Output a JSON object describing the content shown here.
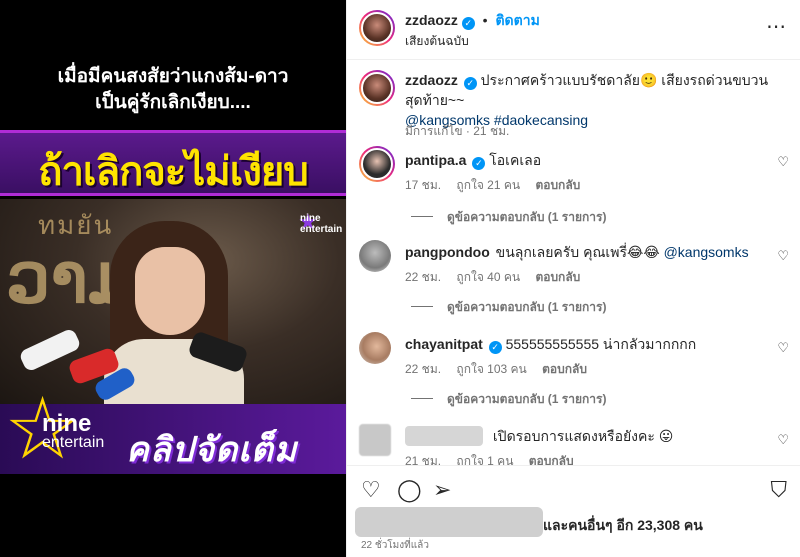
{
  "media": {
    "caption_line1": "เมื่อมีคนสงสัยว่าแกงส้ม-ดาว",
    "caption_line2": "เป็นคู่รักเลิกเงียบ....",
    "headline": "ถ้าเลิกจะไม่เงียบ",
    "background_text_top": "ทมยัน",
    "background_text_large": "ວາມ",
    "watermark_small": "nine entertain",
    "brand_nine": "nine",
    "brand_entertain": "entertain",
    "clip_label": "คลิปจัดเต็ม"
  },
  "post": {
    "author": "zzdaozz",
    "follow_label": "ติดตาม",
    "audio_label": "เสียงต้นฉบับ",
    "more_icon": "more-options-icon",
    "caption": {
      "username": "zzdaozz",
      "text": "ประกาศคร้าวแบบรัชดาลัย🙂 เสียงรถด่วนขบวนสุดท้าย~~",
      "mentions": "@kangsomks #daokecansing",
      "edited": "มีการแก้ไข · 21 ชม."
    }
  },
  "comments": [
    {
      "username": "pantipa.a",
      "verified": true,
      "text": "โอเคเลอ",
      "time": "17 ชม.",
      "likes": "ถูกใจ 21 คน",
      "reply": "ตอบกลับ",
      "view_replies": "ดูข้อความตอบกลับ (1 รายการ)"
    },
    {
      "username": "pangpondoo",
      "verified": false,
      "text": "ขนลุกเลยครับ คุณเพรี่😂😂 ",
      "mention": "@kangsomks",
      "time": "22 ชม.",
      "likes": "ถูกใจ 40 คน",
      "reply": "ตอบกลับ",
      "view_replies": "ดูข้อความตอบกลับ (1 รายการ)"
    },
    {
      "username": "chayanitpat",
      "verified": true,
      "text": "555555555555 น่ากลัวมากกกก",
      "time": "22 ชม.",
      "likes": "ถูกใจ 103 คน",
      "reply": "ตอบกลับ",
      "view_replies": "ดูข้อความตอบกลับ (1 รายการ)"
    },
    {
      "username": "",
      "verified": false,
      "text": "เปิดรอบการแสดงหรือยังคะ 😛",
      "time": "21 ชม.",
      "likes": "ถูกใจ 1 คน",
      "reply": "ตอบกลับ"
    }
  ],
  "actions": {
    "like_icon": "heart-icon",
    "comment_icon": "comment-icon",
    "share_icon": "share-icon",
    "save_icon": "bookmark-icon"
  },
  "likes_summary": "และคนอื่นๆ อีก 23,308 คน",
  "posted_ago": "22 ชั่วโมงที่แล้ว",
  "colors": {
    "accent": "#0095f6",
    "mention": "#00376b",
    "muted": "#737373",
    "headline_yellow": "#ffe400",
    "band_purple": "#5b1a8c"
  }
}
